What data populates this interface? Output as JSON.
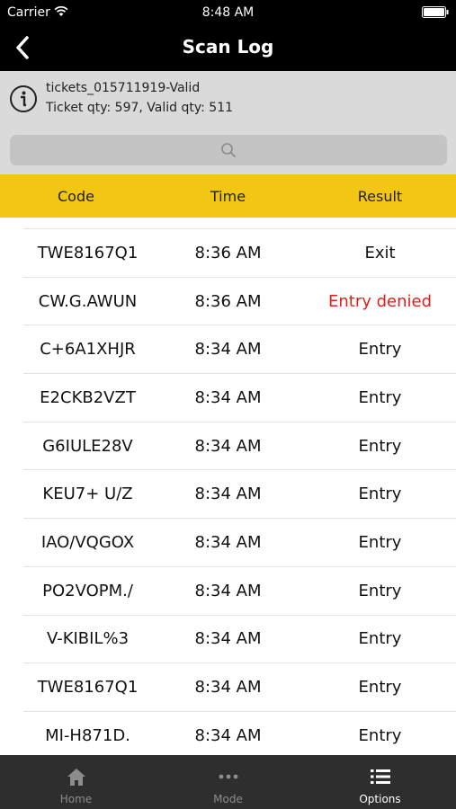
{
  "status_bar": {
    "carrier": "Carrier",
    "time": "8:48 AM"
  },
  "nav": {
    "title": "Scan Log",
    "back_icon": "chevron-left-icon"
  },
  "info": {
    "icon": "info-icon",
    "line1": "tickets_015711919-Valid",
    "line2": "Ticket qty: 597, Valid qty: 511"
  },
  "search": {
    "placeholder": "",
    "icon": "search-icon"
  },
  "table": {
    "columns": [
      "Code",
      "Time",
      "Result"
    ],
    "rows": [
      {
        "code": "TWE8167Q1",
        "time": "8:36 AM",
        "result": "Exit"
      },
      {
        "code": "CW.G.AWUN",
        "time": "8:36 AM",
        "result": "Entry denied"
      },
      {
        "code": "C+6A1XHJR",
        "time": "8:34 AM",
        "result": "Entry"
      },
      {
        "code": "E2CKB2VZT",
        "time": "8:34 AM",
        "result": "Entry"
      },
      {
        "code": "G6IULE28V",
        "time": "8:34 AM",
        "result": "Entry"
      },
      {
        "code": "KEU7+ U/Z",
        "time": "8:34 AM",
        "result": "Entry"
      },
      {
        "code": "IAO/VQGOX",
        "time": "8:34 AM",
        "result": "Entry"
      },
      {
        "code": "PO2VOPM./",
        "time": "8:34 AM",
        "result": "Entry"
      },
      {
        "code": "V-KIBIL%3",
        "time": "8:34 AM",
        "result": "Entry"
      },
      {
        "code": "TWE8167Q1",
        "time": "8:34 AM",
        "result": "Entry"
      },
      {
        "code": "MI-H871D.",
        "time": "8:34 AM",
        "result": "Entry"
      }
    ]
  },
  "tabs": [
    {
      "label": "Home",
      "icon": "home-icon"
    },
    {
      "label": "Mode",
      "icon": "ellipsis-icon"
    },
    {
      "label": "Options",
      "icon": "list-icon",
      "active": true
    }
  ],
  "colors": {
    "header_yellow": "#f3c614",
    "denied_red": "#e3201b",
    "tabbar": "#2e2e2e"
  }
}
